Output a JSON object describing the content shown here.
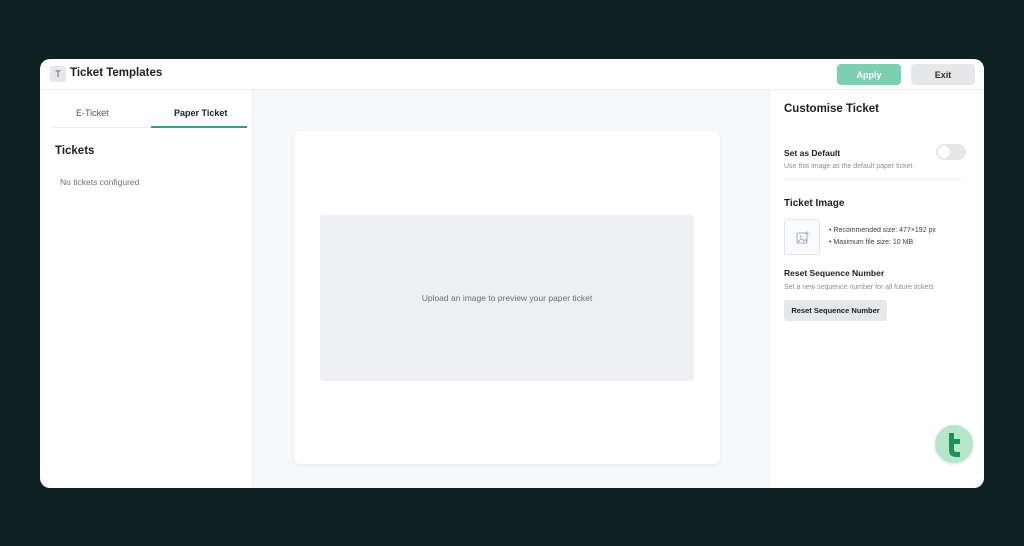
{
  "header": {
    "badge": "T",
    "title": "Ticket Templates",
    "apply_label": "Apply",
    "exit_label": "Exit"
  },
  "left_panel": {
    "tabs": [
      {
        "label": "E-Ticket",
        "active": false
      },
      {
        "label": "Paper Ticket",
        "active": true
      }
    ],
    "section_title": "Tickets",
    "empty_message": "No tickets configured"
  },
  "preview": {
    "placeholder": "Upload an image to preview your paper ticket"
  },
  "right_panel": {
    "title": "Customise Ticket",
    "default": {
      "label": "Set as Default",
      "help": "Use this image as the default paper ticket",
      "enabled": false
    },
    "ticket_image": {
      "title": "Ticket Image",
      "bullets": [
        "• Recommended size: 477×192 px",
        "• Maximum file size: 10 MB"
      ]
    },
    "reset": {
      "title": "Reset Sequence Number",
      "help": "Set a new sequence number for all future tickets",
      "button_label": "Reset Sequence Number"
    }
  },
  "colors": {
    "accent": "#2ba37d",
    "apply_button": "#7dcfb2",
    "background": "#0f2222",
    "fab": "#b6e6c9"
  },
  "icons": {
    "image_placeholder": "image-add-icon",
    "assistant": "brand-t-logo-icon"
  }
}
